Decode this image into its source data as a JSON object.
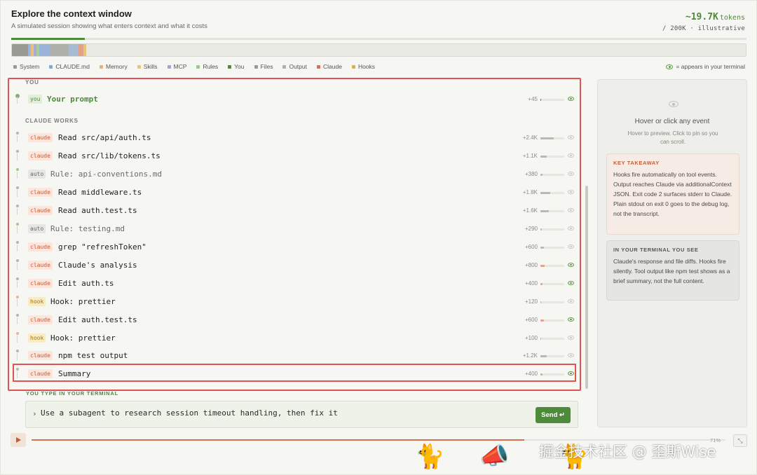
{
  "header": {
    "title": "Explore the context window",
    "subtitle": "A simulated session showing what enters context and what it costs",
    "tokens_value": "~19.7K",
    "tokens_unit": "tokens",
    "tokens_sub": "/ 200K · illustrative",
    "session_progress": 0.1
  },
  "context_segments": [
    {
      "type": "System",
      "fraction": 0.0215,
      "color": "#9a9a94"
    },
    {
      "type": "CLAUDE.md",
      "fraction": 0.003,
      "color": "#9ab3d8"
    },
    {
      "type": "Memory",
      "fraction": 0.0025,
      "color": "#e6b27c"
    },
    {
      "type": "Skills",
      "fraction": 0.003,
      "color": "#e3c57c"
    },
    {
      "type": "MCP",
      "fraction": 0.0035,
      "color": "#b1a6d8"
    },
    {
      "type": "Rules",
      "fraction": 0.0035,
      "color": "#a9cf99"
    },
    {
      "type": "Files",
      "fraction": 0.015,
      "color": "#9ab3d8"
    },
    {
      "type": "Output",
      "fraction": 0.025,
      "color": "#b0b0aa"
    },
    {
      "type": "Files",
      "fraction": 0.014,
      "color": "#a7bcd2"
    },
    {
      "type": "Claude",
      "fraction": 0.006,
      "color": "#e0a184"
    },
    {
      "type": "Hooks",
      "fraction": 0.004,
      "color": "#e3c57c"
    }
  ],
  "legend": {
    "items": [
      {
        "label": "System",
        "color": "#9a9a94"
      },
      {
        "label": "CLAUDE.md",
        "color": "#8aa7d6"
      },
      {
        "label": "Memory",
        "color": "#e6b27c"
      },
      {
        "label": "Skills",
        "color": "#e3c57c"
      },
      {
        "label": "MCP",
        "color": "#a99ed6"
      },
      {
        "label": "Rules",
        "color": "#9ac98a"
      },
      {
        "label": "You",
        "color": "#4d8a3a"
      },
      {
        "label": "Files",
        "color": "#9a9a94"
      },
      {
        "label": "Output",
        "color": "#b0b0aa"
      },
      {
        "label": "Claude",
        "color": "#d4734b"
      },
      {
        "label": "Hooks",
        "color": "#d6b255"
      }
    ],
    "visible_note": "= appears in your terminal"
  },
  "sections": {
    "you": "YOU",
    "claude_works": "CLAUDE WORKS"
  },
  "events": [
    {
      "tag": "you",
      "text": "Your prompt",
      "tokens": "+45",
      "fill": 0.02,
      "visible": true
    },
    {
      "tag": "claude",
      "text": "Read src/api/auth.ts",
      "tokens": "+2.4K",
      "fill": 0.55,
      "visible": false
    },
    {
      "tag": "claude",
      "text": "Read src/lib/tokens.ts",
      "tokens": "+1.1K",
      "fill": 0.25,
      "visible": false
    },
    {
      "tag": "auto",
      "text": "Rule: api-conventions.md",
      "tokens": "+380",
      "fill": 0.09,
      "visible": false
    },
    {
      "tag": "claude",
      "text": "Read middleware.ts",
      "tokens": "+1.8K",
      "fill": 0.41,
      "visible": false
    },
    {
      "tag": "claude",
      "text": "Read auth.test.ts",
      "tokens": "+1.6K",
      "fill": 0.36,
      "visible": false
    },
    {
      "tag": "auto",
      "text": "Rule: testing.md",
      "tokens": "+290",
      "fill": 0.07,
      "visible": false
    },
    {
      "tag": "claude",
      "text": "grep \"refreshToken\"",
      "tokens": "+600",
      "fill": 0.14,
      "visible": false
    },
    {
      "tag": "claude",
      "text": "Claude's analysis",
      "tokens": "+800",
      "fill": 0.18,
      "visible": true
    },
    {
      "tag": "claude",
      "text": "Edit auth.ts",
      "tokens": "+400",
      "fill": 0.09,
      "visible": true
    },
    {
      "tag": "hook",
      "text": "Hook: prettier",
      "tokens": "+120",
      "fill": 0.03,
      "visible": false
    },
    {
      "tag": "claude",
      "text": "Edit auth.test.ts",
      "tokens": "+600",
      "fill": 0.14,
      "visible": true
    },
    {
      "tag": "hook",
      "text": "Hook: prettier",
      "tokens": "+100",
      "fill": 0.02,
      "visible": false
    },
    {
      "tag": "claude",
      "text": "npm test output",
      "tokens": "+1.2K",
      "fill": 0.27,
      "visible": false
    },
    {
      "tag": "claude",
      "text": "Summary",
      "tokens": "+400",
      "fill": 0.09,
      "visible": true
    }
  ],
  "input": {
    "label": "YOU TYPE IN YOUR TERMINAL",
    "chevron": "›",
    "value": "Use a subagent to research session timeout handling, then fix it",
    "send_label": "Send ↵"
  },
  "player": {
    "progress_label": "71%",
    "progress": 0.71,
    "play_icon": "play-icon",
    "expand_icon": "expand-icon"
  },
  "panel": {
    "title": "Hover or click any event",
    "hint": "Hover to preview. Click to pin so you can scroll.",
    "takeaway_title": "KEY TAKEAWAY",
    "takeaway_body": "Hooks fire automatically on tool events. Output reaches Claude via additionalContext JSON. Exit code 2 surfaces stderr to Claude. Plain stdout on exit 0 goes to the debug log, not the transcript.",
    "terminal_title": "IN YOUR TERMINAL YOU SEE",
    "terminal_body": "Claude's response and file diffs. Hooks fire silently. Tool output like npm test shows as a brief summary, not the full content."
  },
  "colors": {
    "accent_green": "#4d8a3a",
    "claude_orange": "#d4734b",
    "highlight_red": "#e05252"
  },
  "watermark": "掘金技术社区 @ 歪斯Wise"
}
